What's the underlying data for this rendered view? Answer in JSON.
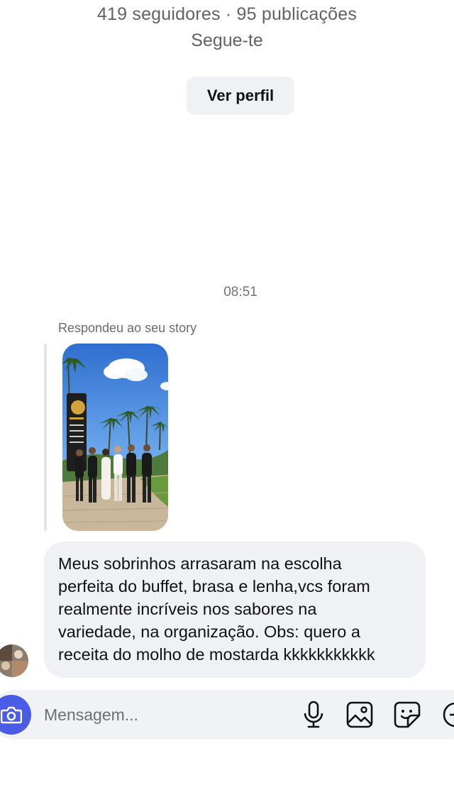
{
  "profile": {
    "stats": "419 seguidores · 95 publicações",
    "follows_you": "Segue-te",
    "view_profile_label": "Ver perfil"
  },
  "thread": {
    "timestamp": "08:51",
    "reply_caption": "Respondeu ao seu story",
    "story_sign_lines": [
      "BUFFET COMPLETO",
      "CHURRASCO",
      "COSTELA DE CHÃO",
      "COMIDA CAMPEIRA"
    ],
    "message_lines": [
      "Meus sobrinhos arrasaram na escolha",
      "perfeita do buffet, brasa e lenha,vcs foram",
      "realmente incríveis nos sabores na",
      "variedade, na organização. Obs: quero a",
      "receita do molho de mostarda kkkkkkkkkkk"
    ]
  },
  "composer": {
    "placeholder": "Mensagem...",
    "icons": [
      "camera-icon",
      "microphone-icon",
      "gallery-icon",
      "sticker-icon",
      "add-icon"
    ]
  },
  "colors": {
    "accent": "#4a5ce6",
    "bubble": "#eff1f4",
    "muted_text": "#737373"
  }
}
